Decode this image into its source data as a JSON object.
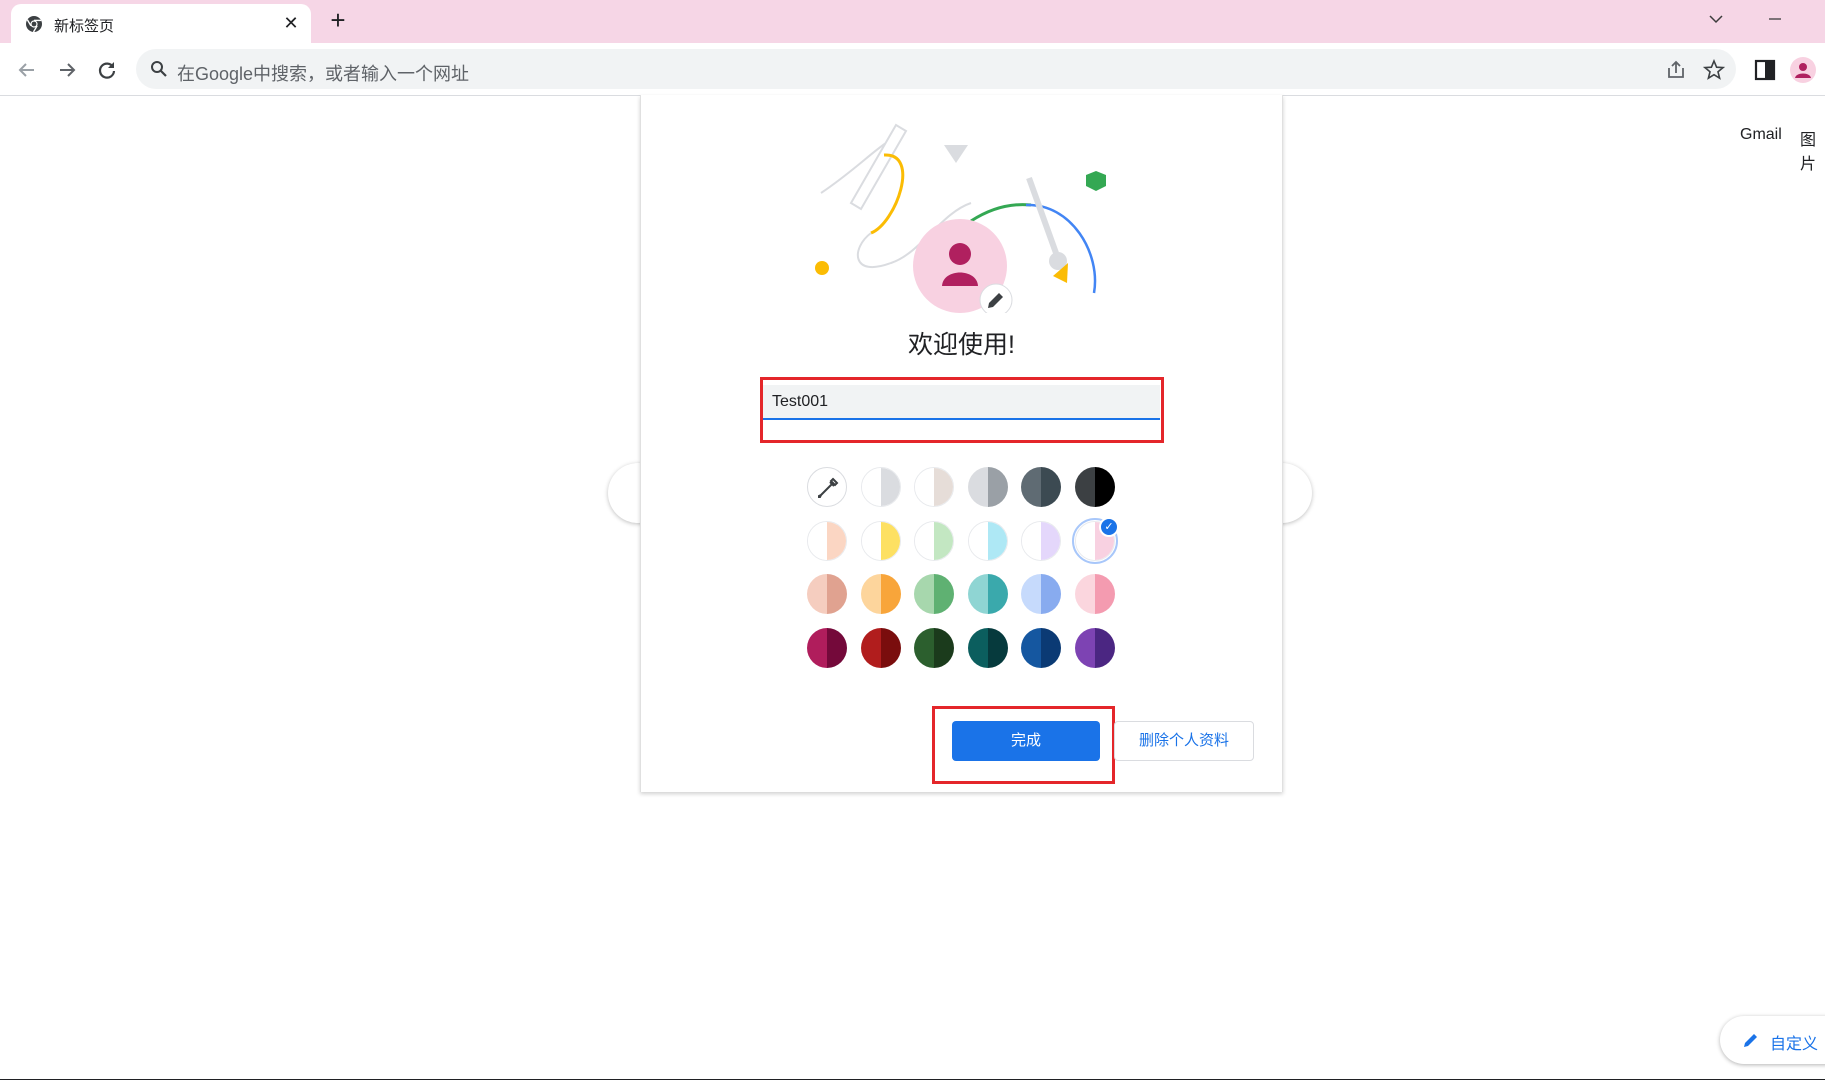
{
  "tab": {
    "title": "新标签页",
    "close": "✕"
  },
  "new_tab": "+",
  "window": {
    "dropdown": "⌄",
    "minimize": "—"
  },
  "omnibox": {
    "placeholder": "在Google中搜索，或者输入一个网址"
  },
  "top_links": {
    "gmail": "Gmail",
    "images": "图片"
  },
  "customize": {
    "label": "自定义"
  },
  "dialog": {
    "title": "欢迎使用!",
    "name_value": "Test001",
    "done_label": "完成",
    "delete_label": "删除个人资料",
    "colors": [
      {
        "name": "custom-color-picker",
        "left": "#ffffff",
        "right": "#ffffff"
      },
      {
        "name": "grey-white",
        "left": "#ffffff",
        "right": "#dadce0"
      },
      {
        "name": "beige-white",
        "left": "#ffffff",
        "right": "#e6ddd8"
      },
      {
        "name": "grey-silver",
        "left": "#dadce0",
        "right": "#9aa0a6"
      },
      {
        "name": "slate",
        "left": "#5f6b73",
        "right": "#3c4a52"
      },
      {
        "name": "black",
        "left": "#3c4043",
        "right": "#000000"
      },
      {
        "name": "peach-light",
        "left": "#ffffff",
        "right": "#fbd6c3"
      },
      {
        "name": "yellow-light",
        "left": "#ffffff",
        "right": "#fde062"
      },
      {
        "name": "green-light",
        "left": "#ffffff",
        "right": "#c3e7c2"
      },
      {
        "name": "cyan-light",
        "left": "#ffffff",
        "right": "#aee8f5"
      },
      {
        "name": "lavender-light",
        "left": "#ffffff",
        "right": "#e4d7fb"
      },
      {
        "name": "pink-light",
        "left": "#ffffff",
        "right": "#f8d1e1"
      },
      {
        "name": "peach",
        "left": "#f5cdbf",
        "right": "#e0a290"
      },
      {
        "name": "orange",
        "left": "#fdd59c",
        "right": "#f8a53a"
      },
      {
        "name": "green",
        "left": "#a7d7ad",
        "right": "#5fb172"
      },
      {
        "name": "teal",
        "left": "#8fd5d3",
        "right": "#3aa9ac"
      },
      {
        "name": "blue",
        "left": "#c6dafc",
        "right": "#88abef"
      },
      {
        "name": "pink",
        "left": "#fbd6de",
        "right": "#f49bb0"
      },
      {
        "name": "magenta-dark",
        "left": "#b01d5c",
        "right": "#74093a"
      },
      {
        "name": "red-dark",
        "left": "#b11d1d",
        "right": "#7a0d0d"
      },
      {
        "name": "green-dark",
        "left": "#2c5f2e",
        "right": "#1b3b1c"
      },
      {
        "name": "teal-dark",
        "left": "#0b5e5e",
        "right": "#063a3d"
      },
      {
        "name": "blue-dark",
        "left": "#1557a0",
        "right": "#0b3a74"
      },
      {
        "name": "purple-dark",
        "left": "#7d43b3",
        "right": "#4b2682"
      }
    ],
    "selected_index": 11
  }
}
